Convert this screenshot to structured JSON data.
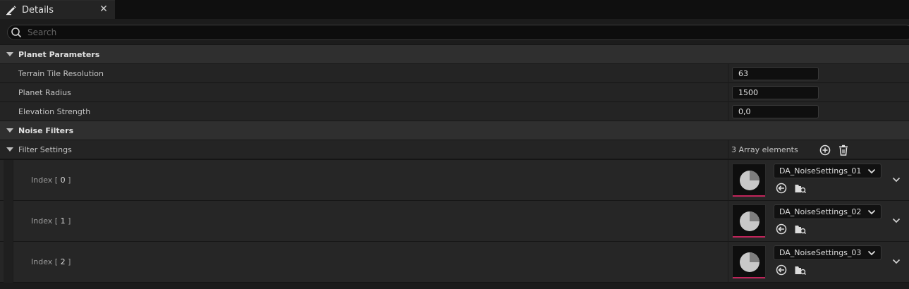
{
  "tab": {
    "title": "Details",
    "icon": "pencil-icon",
    "close": "✕"
  },
  "search": {
    "placeholder": "Search",
    "value": ""
  },
  "categories": {
    "planet": "Planet Parameters",
    "noise": "Noise Filters"
  },
  "properties": [
    {
      "label": "Terrain Tile Resolution",
      "value": "63"
    },
    {
      "label": "Planet Radius",
      "value": "1500"
    },
    {
      "label": "Elevation Strength",
      "value": "0,0"
    }
  ],
  "filter_settings": {
    "label": "Filter Settings",
    "count": "3 Array elements",
    "elements": [
      {
        "index_prefix": "Index [ ",
        "index": "0",
        "index_suffix": " ]",
        "asset": "DA_NoiseSettings_01"
      },
      {
        "index_prefix": "Index [ ",
        "index": "1",
        "index_suffix": " ]",
        "asset": "DA_NoiseSettings_02"
      },
      {
        "index_prefix": "Index [ ",
        "index": "2",
        "index_suffix": " ]",
        "asset": "DA_NoiseSettings_03"
      }
    ]
  },
  "colors": {
    "accent": "#c0245a",
    "background": "#242424",
    "category": "#2f2f2f"
  }
}
